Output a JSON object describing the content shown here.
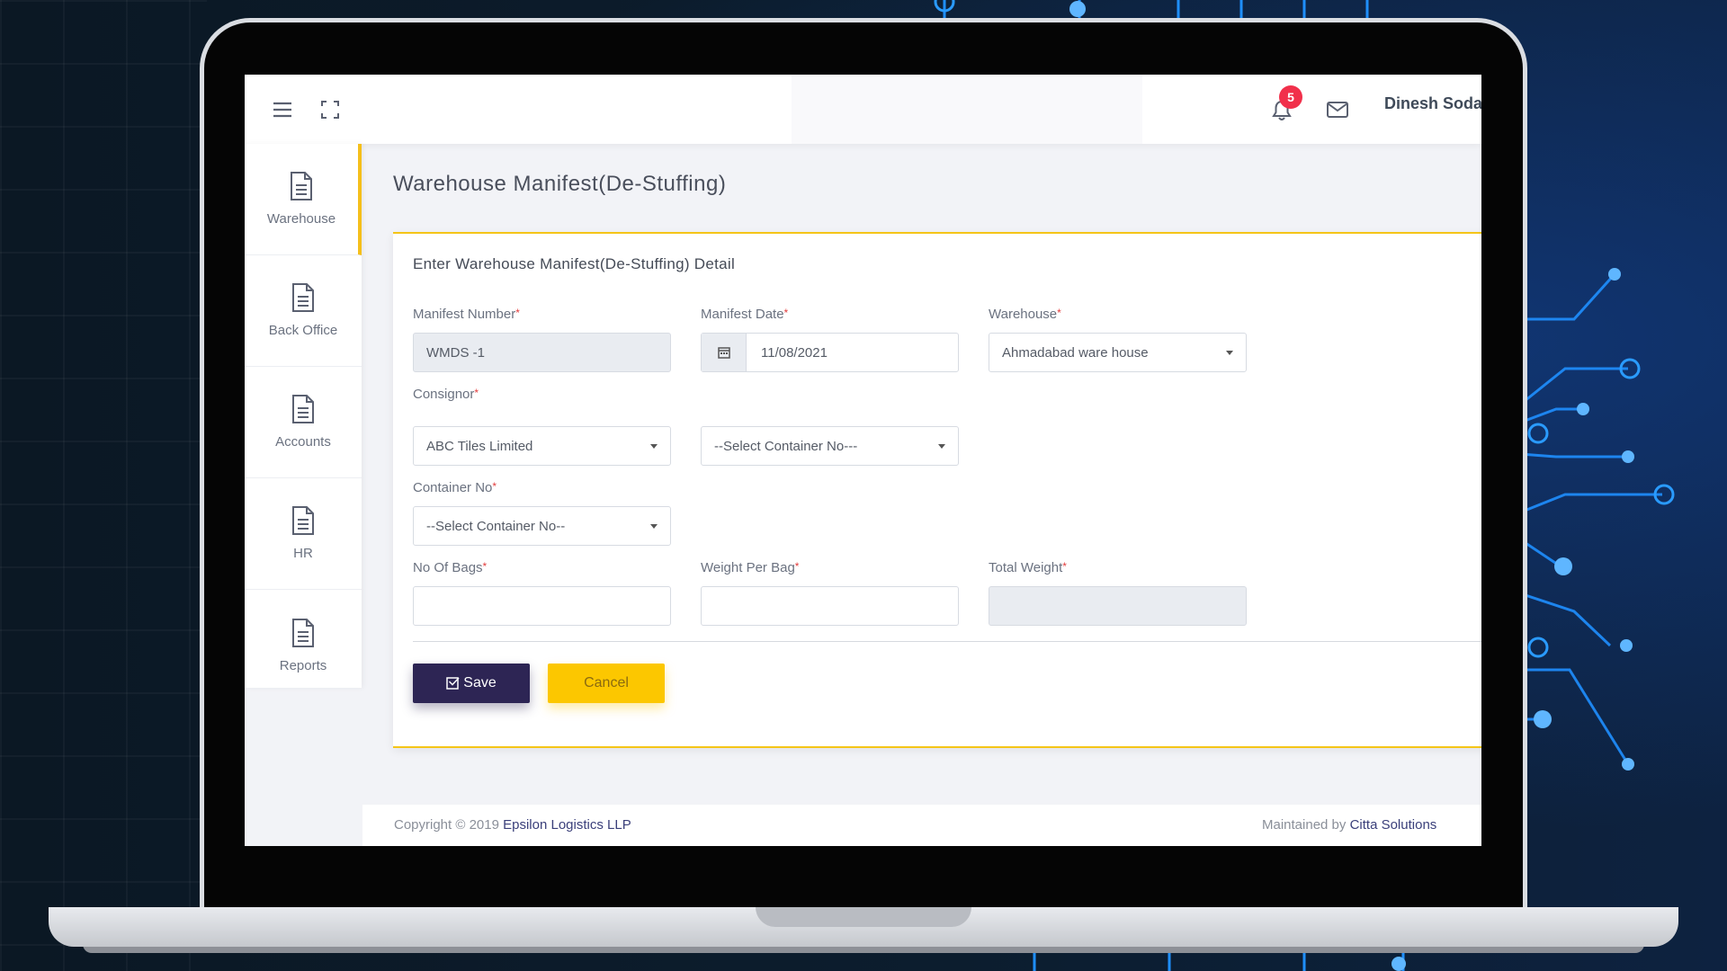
{
  "header": {
    "notification_count": "5",
    "user_name": "Dinesh Sodar"
  },
  "sidebar": {
    "items": [
      {
        "label": "Warehouse",
        "active": true
      },
      {
        "label": "Back Office",
        "active": false
      },
      {
        "label": "Accounts",
        "active": false
      },
      {
        "label": "HR",
        "active": false
      },
      {
        "label": "Reports",
        "active": false
      }
    ]
  },
  "page": {
    "title": "Warehouse Manifest(De-Stuffing)"
  },
  "form": {
    "card_title": "Enter Warehouse Manifest(De-Stuffing) Detail",
    "required_mark": "*",
    "manifest_number": {
      "label": "Manifest Number",
      "value": "WMDS -1"
    },
    "manifest_date": {
      "label": "Manifest Date",
      "value": "11/08/2021"
    },
    "warehouse": {
      "label": "Warehouse",
      "value": "Ahmadabad ware house"
    },
    "consignor": {
      "label": "Consignor",
      "value": "ABC Tiles Limited"
    },
    "container_select_a": {
      "value": "--Select Container No---"
    },
    "container_no": {
      "label": "Container No",
      "value": "--Select Container No--"
    },
    "no_of_bags": {
      "label": "No Of Bags",
      "value": ""
    },
    "weight_per_bag": {
      "label": "Weight Per Bag",
      "value": ""
    },
    "total_weight": {
      "label": "Total Weight",
      "value": ""
    },
    "save_label": "Save",
    "cancel_label": "Cancel"
  },
  "footer": {
    "copyright_prefix": "Copyright © 2019",
    "company": "Epsilon Logistics LLP",
    "maintained_prefix": "Maintained by",
    "maintainer": "Citta Solutions"
  },
  "colors": {
    "accent_yellow": "#f5c518",
    "primary_dark": "#2d2554",
    "badge_red": "#f1304b"
  }
}
